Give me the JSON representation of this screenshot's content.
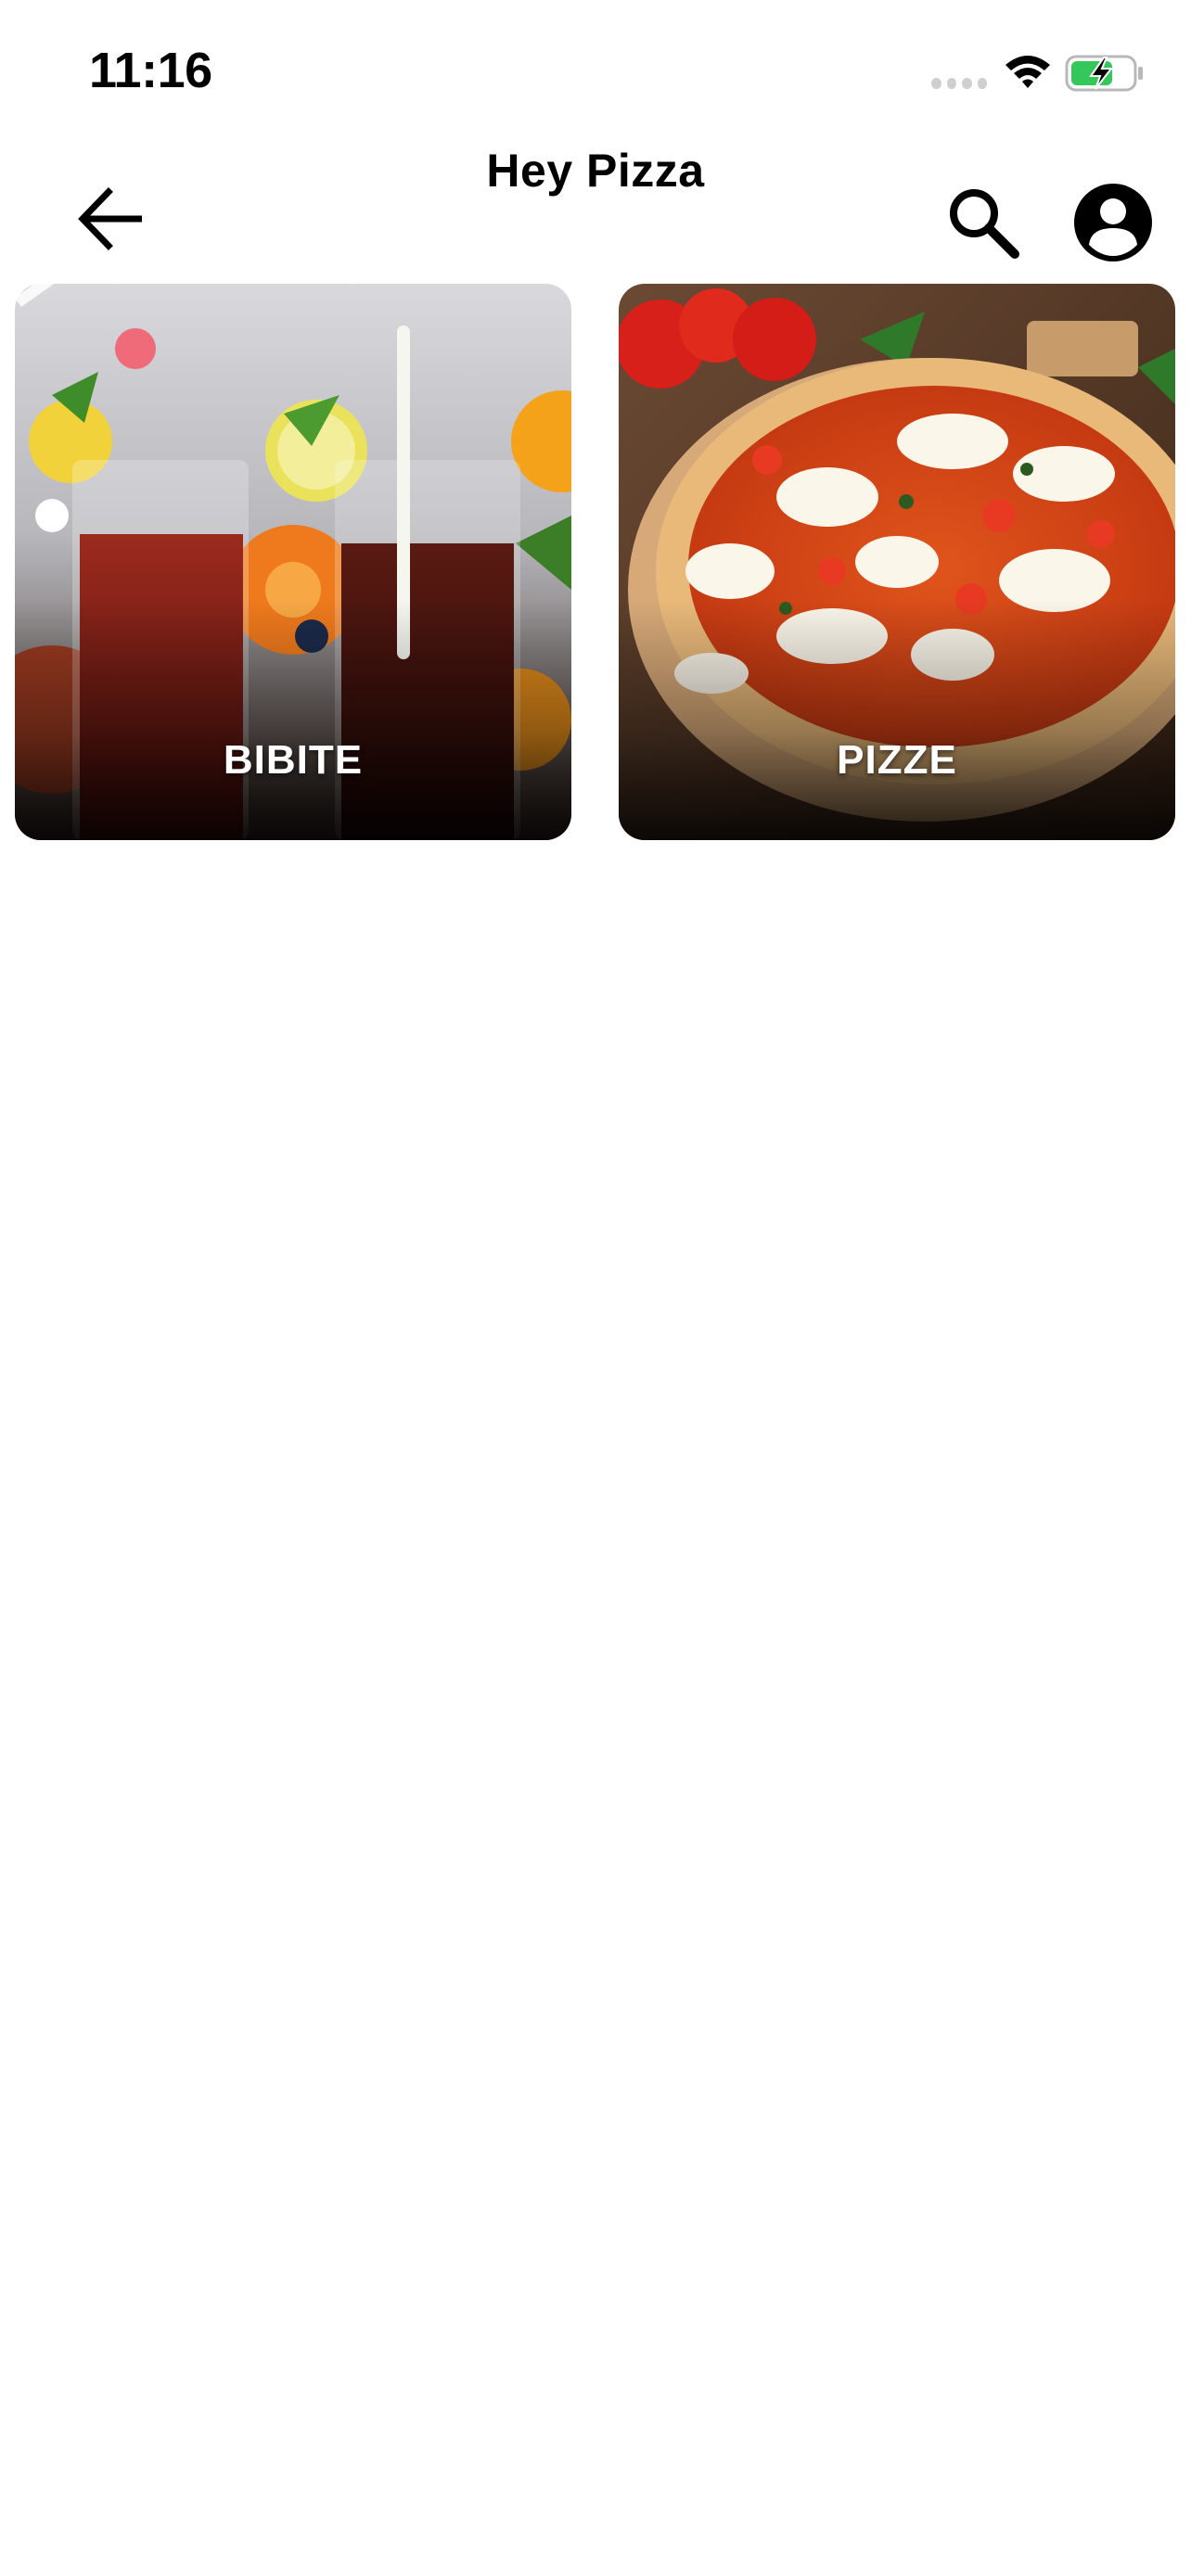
{
  "status_bar": {
    "time": "11:16",
    "icons": [
      "signal-dots-icon",
      "wifi-icon",
      "battery-charging-icon"
    ]
  },
  "header": {
    "title": "Hey Pizza",
    "back_icon": "arrow-left-icon",
    "search_icon": "search-icon",
    "profile_icon": "account-circle-icon"
  },
  "categories": [
    {
      "label": "BIBITE",
      "image": "drinks-photo"
    },
    {
      "label": "PIZZE",
      "image": "pizza-photo"
    }
  ],
  "colors": {
    "background": "#ffffff",
    "text": "#000000",
    "card_label": "#ffffff",
    "battery_fill": "#34c759"
  }
}
